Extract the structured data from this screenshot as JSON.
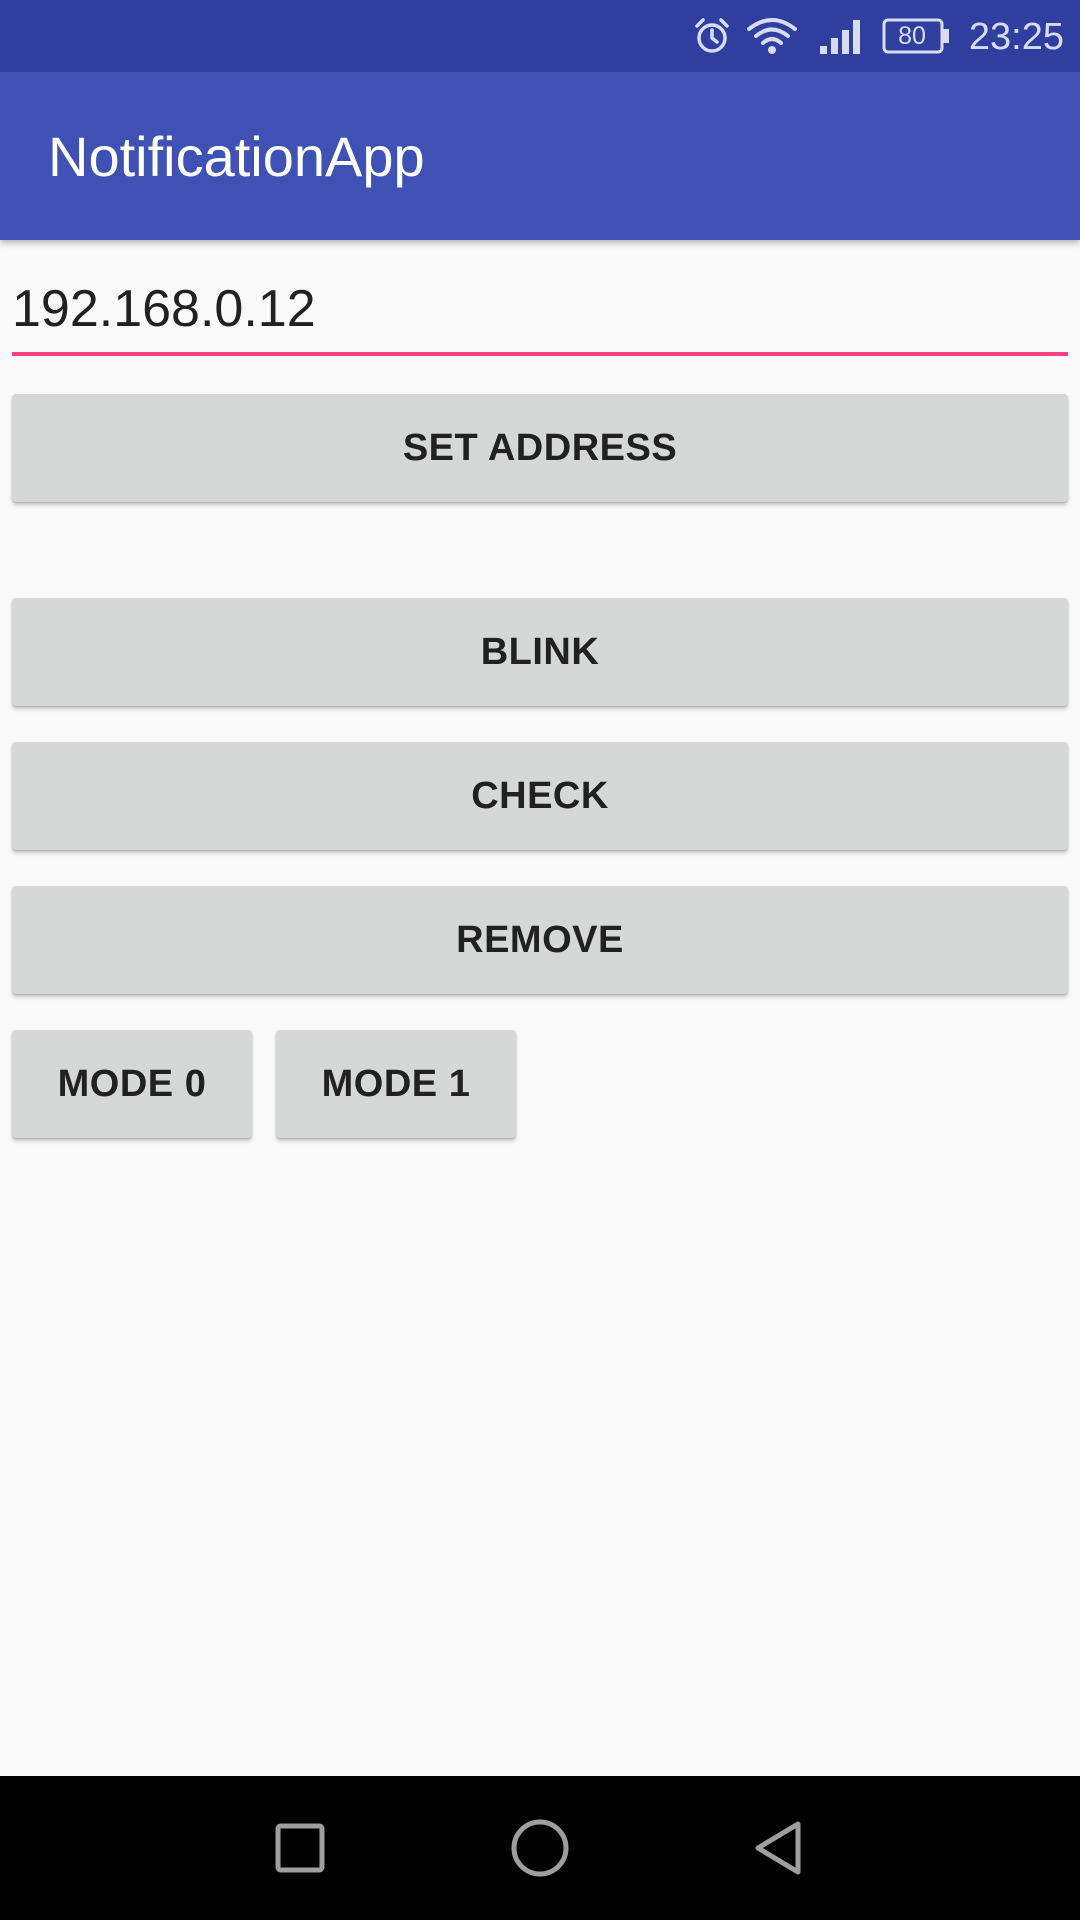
{
  "status_bar": {
    "battery_level": "80",
    "time": "23:25",
    "icons": [
      "alarm-icon",
      "wifi-icon",
      "cell-signal-icon",
      "battery-icon"
    ]
  },
  "app_bar": {
    "title": "NotificationApp"
  },
  "address_field": {
    "value": "192.168.0.12"
  },
  "buttons": {
    "set_address": "SET ADDRESS",
    "blink": "BLINK",
    "check": "CHECK",
    "remove": "REMOVE",
    "mode0": "MODE 0",
    "mode1": "MODE 1"
  },
  "nav_bar": {
    "icons": [
      "recents-icon",
      "home-icon",
      "back-icon"
    ]
  },
  "colors": {
    "status_bar": "#303f9f",
    "primary": "#3f51b5",
    "accent": "#ff4081",
    "button": "#d6d7d7",
    "background": "#fafafa"
  }
}
